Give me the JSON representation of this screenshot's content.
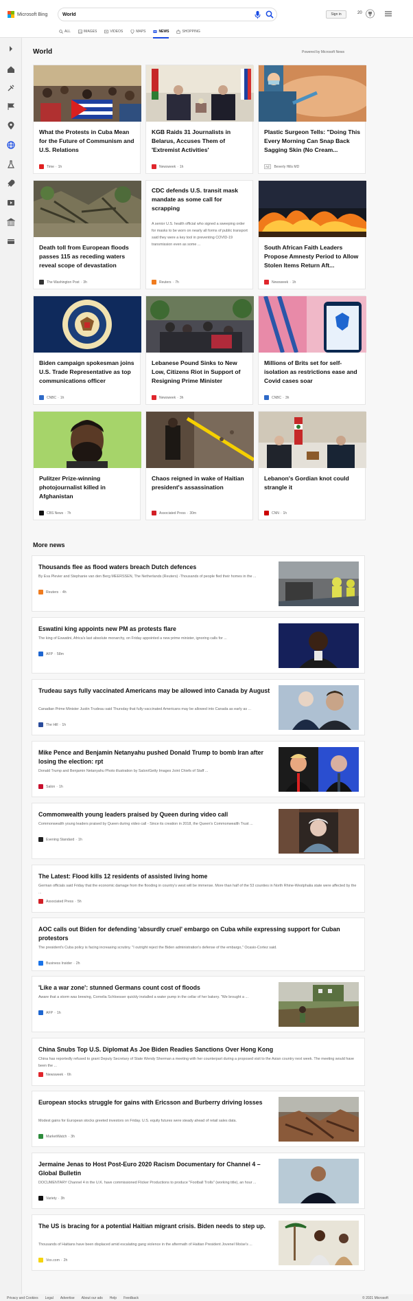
{
  "header": {
    "brand": "Microsoft Bing",
    "search_value": "World",
    "signin_label": "Sign in",
    "points": "20",
    "nav": [
      {
        "label": "ALL",
        "icon": "search-icon"
      },
      {
        "label": "IMAGES",
        "icon": "image-icon"
      },
      {
        "label": "VIDEOS",
        "icon": "video-icon"
      },
      {
        "label": "MAPS",
        "icon": "map-pin-icon"
      },
      {
        "label": "NEWS",
        "icon": "news-icon",
        "active": true
      },
      {
        "label": "SHOPPING",
        "icon": "shopping-bag-icon"
      }
    ]
  },
  "section": {
    "title": "World",
    "powered": "Powered by Microsoft News"
  },
  "cards": [
    {
      "title": "What the Protests in Cuba Mean for the Future of Communism and U.S. Relations",
      "source": "Time",
      "age": "1h",
      "brand_color": "#e02020"
    },
    {
      "title": "KGB Raids 31 Journalists in Belarus, Accuses Them of 'Extremist Activities'",
      "source": "Newsweek",
      "age": "1h",
      "brand_color": "#e0262c"
    },
    {
      "title": "Plastic Surgeon Tells: \"Doing This Every Morning Can Snap Back Sagging Skin (No Cream...",
      "source": "Beverly Hills MD",
      "ad": "Ad",
      "brand_color": "#999999"
    },
    {
      "title": "Death toll from European floods passes 115 as receding waters reveal scope of devastation",
      "source": "The Washington Post",
      "age": "3h",
      "brand_color": "#333333"
    },
    {
      "title": "CDC defends U.S. transit mask mandate as some call for scrapping",
      "description": "A senior U.S. health official who signed a sweeping order for masks to be worn on nearly all forms of public transport said they were a key tool in preventing COVID-19 transmission even as some ...",
      "source": "Reuters",
      "age": "7h",
      "brand_color": "#f07c1f"
    },
    {
      "title": "South African Faith Leaders Propose Amnesty Period to Allow Stolen Items Return Aft...",
      "source": "Newsweek",
      "age": "1h",
      "brand_color": "#e0262c"
    },
    {
      "title": "Biden campaign spokesman joins U.S. Trade Representative as top communications officer",
      "source": "CNBC",
      "age": "1h",
      "brand_color": "#2f6ac7"
    },
    {
      "title": "Lebanese Pound Sinks to New Low, Citizens Riot in Support of Resigning Prime Minister",
      "source": "Newsweek",
      "age": "3h",
      "brand_color": "#e0262c"
    },
    {
      "title": "Millions of Brits set for self-isolation as restrictions ease and Covid cases soar",
      "source": "CNBC",
      "age": "3h",
      "brand_color": "#2f6ac7"
    },
    {
      "title": "Pulitzer Prize-winning photojournalist killed in Afghanistan",
      "source": "CBS News",
      "age": "7h",
      "brand_color": "#111111"
    },
    {
      "title": "Chaos reigned in wake of Haitian president's assassination",
      "source": "Associated Press",
      "age": "30m",
      "brand_color": "#d21f26"
    },
    {
      "title": "Lebanon's Gordian knot could strangle it",
      "source": "CNN",
      "age": "1h",
      "brand_color": "#cc0000"
    }
  ],
  "more": {
    "title": "More news",
    "items": [
      {
        "title": "Thousands flee as flood waters breach Dutch defences",
        "desc": "By Eva Plevier and Stephanie van den Berg MEERSSEN, The Netherlands (Reuters) -Thousands of people fled their homes in the ...",
        "source": "Reuters",
        "age": "4h",
        "brand_color": "#f07c1f"
      },
      {
        "title": "Eswatini king appoints new PM as protests flare",
        "desc": "The king of Eswatini, Africa's last absolute monarchy, on Friday appointed a new prime minister, ignoring calls for ...",
        "source": "AFP",
        "age": "58m",
        "brand_color": "#1e66d0"
      },
      {
        "title": "Trudeau says fully vaccinated Americans may be allowed into Canada by August",
        "desc": "Canadian Prime Minister Justin Trudeau said Thursday that fully-vaccinated Americans may be allowed into Canada as early as ...",
        "source": "The Hill",
        "age": "1h",
        "brand_color": "#2a4b9b"
      },
      {
        "title": "Mike Pence and Benjamin Netanyahu pushed Donald Trump to bomb Iran after losing the election: rpt",
        "desc": "Donald Trump and Benjamin Netanyahu Photo illustration by Salon/Getty Images Joint Chiefs of Staff ...",
        "source": "Salon",
        "age": "1h",
        "brand_color": "#c8102e"
      },
      {
        "title": "Commonwealth young leaders praised by Queen during video call",
        "desc": "Commonwealth young leaders praised by Queen during video call - Since its creation in 2018, the Queen's Commonwealth Trust ...",
        "source": "Evening Standard",
        "age": "1h",
        "brand_color": "#222222"
      },
      {
        "title": "The Latest: Flood kills 12 residents of assisted living home",
        "desc": "German officials said Friday that the economic damage from the flooding in country's west will be immense. More than half of the 53 counties in North Rhine-Westphalia state were affected by the ...",
        "source": "Associated Press",
        "age": "5h",
        "brand_color": "#d21f26"
      },
      {
        "title": "AOC calls out Biden for defending 'absurdly cruel' embargo on Cuba while expressing support for Cuban protestors",
        "desc": "The president's Cuba policy is facing increasing scrutiny. \"I outright reject the Biden administration's defense of the embargo,\" Ocasio-Cortez said.",
        "source": "Business Insider",
        "age": "2h",
        "brand_color": "#1a73e8"
      },
      {
        "title": "'Like a war zone': stunned Germans count cost of floods",
        "desc": "Aware that a storm was brewing, Cornelia Schloesser quickly installed a water pump in the cellar of her bakery. \"We brought a ...",
        "source": "AFP",
        "age": "1h",
        "brand_color": "#1e66d0"
      },
      {
        "title": "China Snubs Top U.S. Diplomat As Joe Biden Readies Sanctions Over Hong Kong",
        "desc": "China has reportedly refused to grant Deputy Secretary of State Wendy Sherman a meeting with her counterpart during a proposed visit to the Asian country next week. The meeting would have been the ...",
        "source": "Newsweek",
        "age": "6h",
        "brand_color": "#e0262c"
      },
      {
        "title": "European stocks struggle for gains with Ericsson and Burberry driving losses",
        "desc": "Modest gains for European stocks greeted investors on Friday. U.S. equity futures were steady ahead of retail sales data.",
        "source": "MarketWatch",
        "age": "3h",
        "brand_color": "#2d8c3c"
      },
      {
        "title": "Jermaine Jenas to Host Post-Euro 2020 Racism Documentary for Channel 4 – Global Bulletin",
        "desc": "DOCUMENTARY Channel 4 in the U.K. have commissioned Flicker Productions to produce \"Football Trolls\" (working title), an hour ...",
        "source": "Variety",
        "age": "3h",
        "brand_color": "#111111"
      },
      {
        "title": "The US is bracing for a potential Haitian migrant crisis. Biden needs to step up.",
        "desc": "Thousands of Haitians have been displaced amid escalating gang violence in the aftermath of Haitian President Jovenel Moïse's ...",
        "source": "Vox.com",
        "age": "2h",
        "brand_color": "#f5d40f"
      }
    ]
  },
  "footer": {
    "links": [
      "Privacy and Cookies",
      "Legal",
      "Advertise",
      "About our ads",
      "Help",
      "Feedback"
    ],
    "copyright": "© 2021 Microsoft"
  }
}
